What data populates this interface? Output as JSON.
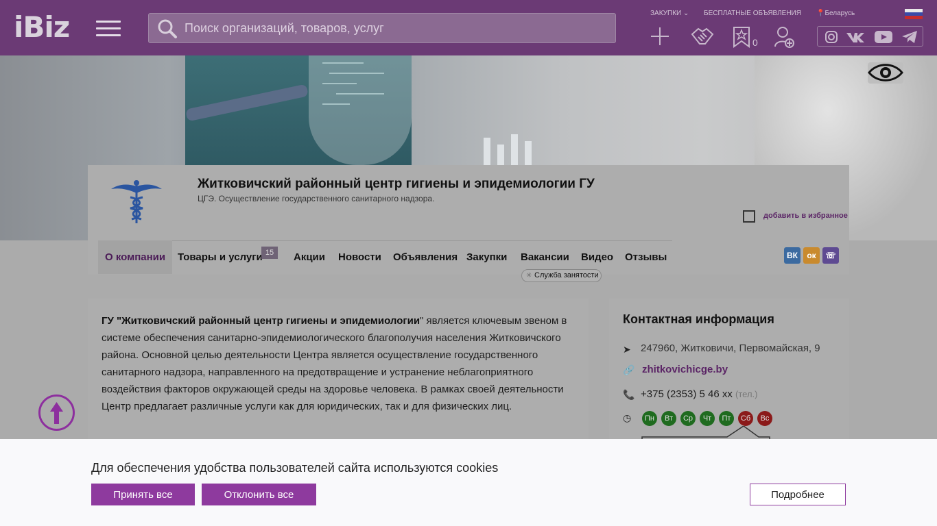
{
  "header": {
    "logo": "iBiz",
    "search_placeholder": "Поиск организаций, товаров, услуг",
    "links": {
      "zakupki": "ЗАКУПКИ",
      "free_ads": "БЕСПЛАТНЫЕ ОБЪЯВЛЕНИЯ",
      "country": "Беларусь"
    },
    "favorites_count": "0"
  },
  "company": {
    "title": "Житковичский районный центр гигиены и эпидемиологии ГУ",
    "subtitle": "ЦГЭ. Осуществление государственного санитарного надзора.",
    "add_favorite": "добавить в избранное"
  },
  "tabs": [
    {
      "label": "О компании"
    },
    {
      "label": "Товары и услуги",
      "badge": "15"
    },
    {
      "label": "Акции"
    },
    {
      "label": "Новости"
    },
    {
      "label": "Объявления"
    },
    {
      "label": "Закупки"
    },
    {
      "label": "Вакансии"
    },
    {
      "label": "Видео"
    },
    {
      "label": "Отзывы"
    }
  ],
  "employment_badge": "Служба занятости",
  "share": {
    "vk": "VK",
    "ok": "OK",
    "viber": "Viber"
  },
  "about": {
    "bold": "ГУ \"Житковичский районный центр гигиены и эпидемиологии",
    "text": "\" является ключевым звеном в системе обеспечения санитарно-эпидемиологического благополучия населения Житковичского района. Основной целью деятельности Центра является осуществление государственного санитарного надзора, направленного на предотвращение и устранение неблагоприятного воздействия факторов окружающей среды на здоровье человека. В рамках своей деятельности Центр предлагает различные услуги как для юридических, так и для физических лиц."
  },
  "contacts": {
    "title": "Контактная информация",
    "address": "247960, Житковичи, Первомайская, 9",
    "website": "zhitkovichicge.by",
    "phone": "+375 (2353) 5 46 xx",
    "phone_type": "(тел.)",
    "days": [
      {
        "label": "Пн",
        "color": "#1f6b1f"
      },
      {
        "label": "Вт",
        "color": "#1f6b1f"
      },
      {
        "label": "Ср",
        "color": "#1f6b1f"
      },
      {
        "label": "Чт",
        "color": "#1f6b1f"
      },
      {
        "label": "Пт",
        "color": "#1f6b1f"
      },
      {
        "label": "Сб",
        "color": "#8b1a1a"
      },
      {
        "label": "Вс",
        "color": "#8b1a1a"
      }
    ]
  },
  "cookie": {
    "text": "Для обеспечения удобства пользователей сайта используются cookies",
    "accept": "Принять все",
    "decline": "Отклонить все",
    "more": "Подробнее"
  },
  "colors": {
    "accent": "#8e3a9e",
    "header": "#6b3a75"
  }
}
